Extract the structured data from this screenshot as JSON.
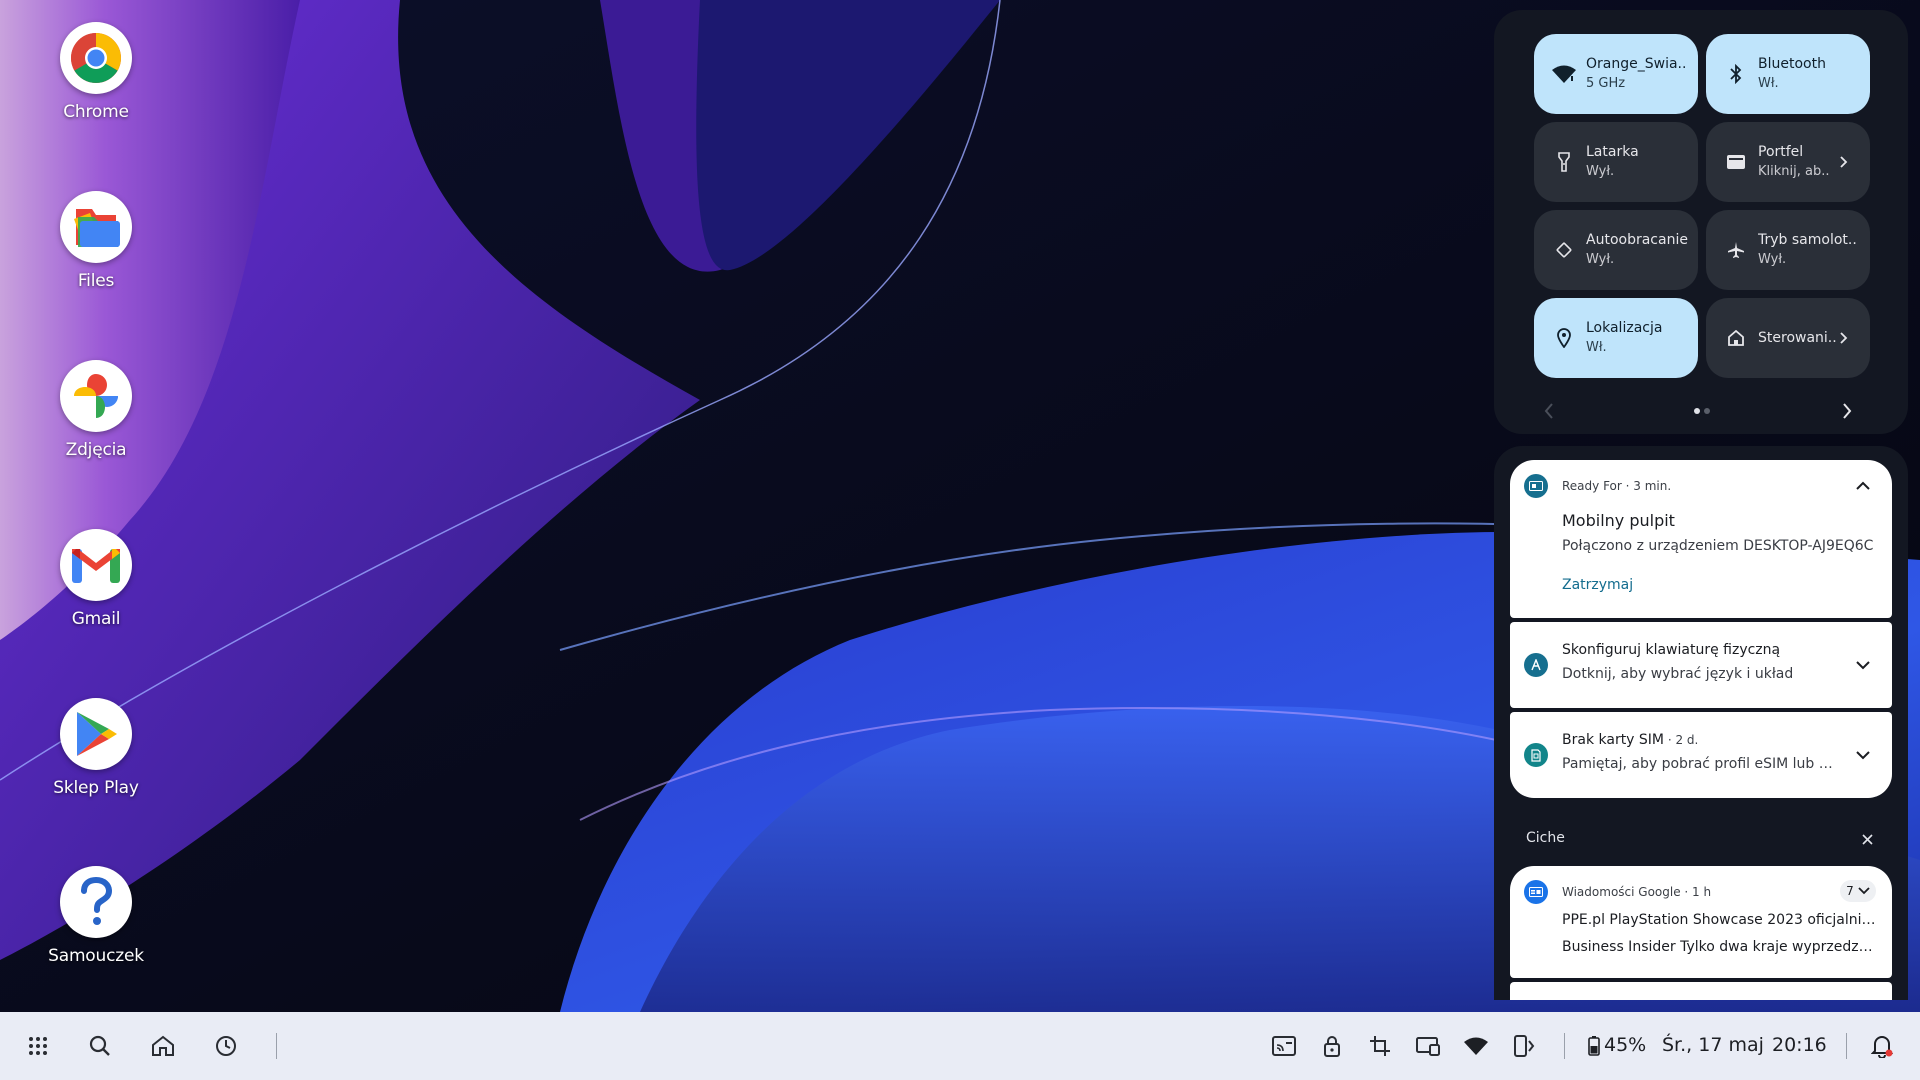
{
  "desktop": {
    "icons": [
      {
        "label": "Chrome",
        "icon": "chrome-icon"
      },
      {
        "label": "Files",
        "icon": "files-icon"
      },
      {
        "label": "Zdjęcia",
        "icon": "photos-icon"
      },
      {
        "label": "Gmail",
        "icon": "gmail-icon"
      },
      {
        "label": "Sklep Play",
        "icon": "play-store-icon"
      },
      {
        "label": "Samouczek",
        "icon": "help-icon"
      }
    ]
  },
  "quick_settings": {
    "tiles": [
      {
        "title": "Orange_Swia..",
        "subtitle": "5 GHz",
        "icon": "wifi-icon",
        "on": true
      },
      {
        "title": "Bluetooth",
        "subtitle": "Wł.",
        "icon": "bluetooth-icon",
        "on": true
      },
      {
        "title": "Latarka",
        "subtitle": "Wył.",
        "icon": "flashlight-icon",
        "on": false
      },
      {
        "title": "Portfel",
        "subtitle": "Kliknij, ab..",
        "icon": "wallet-icon",
        "on": false
      },
      {
        "title": "Autoobracanie",
        "subtitle": "Wył.",
        "icon": "auto-rotate-icon",
        "on": false
      },
      {
        "title": "Tryb samolot..",
        "subtitle": "Wył.",
        "icon": "airplane-icon",
        "on": false
      },
      {
        "title": "Lokalizacja",
        "subtitle": "Wł.",
        "icon": "location-icon",
        "on": true
      },
      {
        "title": "Sterowani..",
        "subtitle": "",
        "icon": "home-control-icon",
        "on": false
      }
    ],
    "pages": 2,
    "current_page": 1
  },
  "notifications": {
    "ready_for": {
      "app": "Ready For",
      "time": "3 min.",
      "title": "Mobilny pulpit",
      "body": "Połączono z urządzeniem DESKTOP-AJ9EQ6C",
      "action": "Zatrzymaj"
    },
    "keyboard": {
      "title": "Skonfiguruj klawiaturę fizyczną",
      "body": "Dotknij, aby wybrać język i układ"
    },
    "sim": {
      "title": "Brak karty SIM",
      "time": "2 d.",
      "body": "Pamiętaj, aby pobrać profil eSIM lub włoż..."
    },
    "silent_header": "Ciche",
    "news": {
      "app": "Wiadomości Google",
      "time": "1 h",
      "count": "7",
      "line1_source": "PPE.pl",
      "line1_text": "PlayStation Showcase 2023 oficjalnie! So...",
      "line2_source": "Business Insider",
      "line2_text": "Tylko dwa kraje wyprzedzają P..."
    }
  },
  "taskbar": {
    "battery": "45%",
    "date": "Śr., 17 maj",
    "time": "20:16"
  },
  "colors": {
    "tile_on": "#bfe4fb",
    "tile_off": "#2a2f38",
    "panel": "#131722",
    "accent_link": "#136c8e",
    "taskbar": "#e9ecf5"
  }
}
